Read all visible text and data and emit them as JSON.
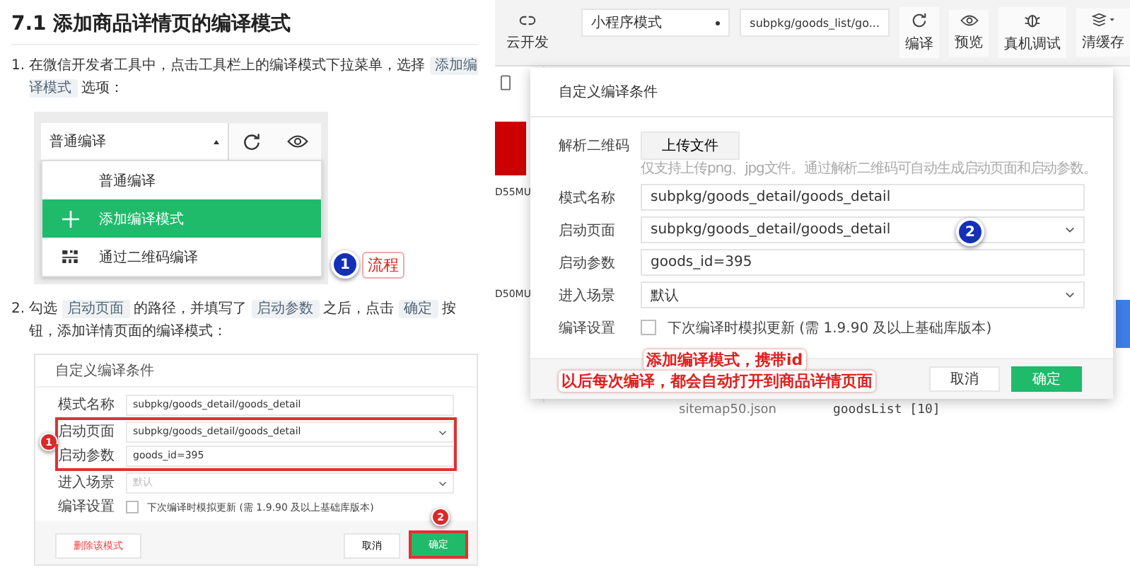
{
  "article": {
    "heading": "7.1 添加商品详情页的编译模式",
    "step_1": {
      "number": "1.",
      "parts": [
        {
          "kind": "text",
          "text": "在微信开发者工具中，点击工具栏上的编译模式下拉菜单，选择"
        },
        {
          "kind": "code",
          "text": "添加编译模式"
        },
        {
          "kind": "text",
          "text": "选项："
        }
      ]
    },
    "figure_1": {
      "mode": "普通编译",
      "menu": [
        {
          "label": "普通编译",
          "selected": false
        },
        {
          "label": "添加编译模式",
          "selected": true
        },
        {
          "label": "通过二维码编译",
          "selected": false
        }
      ],
      "callout": {
        "badge": "1",
        "label": "流程"
      }
    },
    "step_2": {
      "number": "2.",
      "parts": [
        {
          "kind": "text",
          "text": "勾选"
        },
        {
          "kind": "code",
          "text": "启动页面"
        },
        {
          "kind": "text",
          "text": "的路径，并填写了"
        },
        {
          "kind": "code",
          "text": "启动参数"
        },
        {
          "kind": "text",
          "text": "之后，点击"
        },
        {
          "kind": "code",
          "text": "确定"
        },
        {
          "kind": "text",
          "text": "按钮，添加详情页面的编译模式："
        }
      ]
    },
    "figure_2": {
      "title": "自定义编译条件",
      "highlight_badge": "1",
      "fields": [
        {
          "label": "模式名称",
          "kind": "input",
          "value": "subpkg/goods_detail/goods_detail",
          "highlighted": false
        },
        {
          "label": "启动页面",
          "kind": "select",
          "value": "subpkg/goods_detail/goods_detail",
          "highlighted": true
        },
        {
          "label": "启动参数",
          "kind": "input",
          "value": "goods_id=395",
          "highlighted": true
        },
        {
          "label": "进入场景",
          "kind": "select",
          "placeholder": "默认",
          "highlighted": false
        },
        {
          "label": "编译设置",
          "kind": "checkbox",
          "text": "下次编译时模拟更新 (需 1.9.90 及以上基础库版本)",
          "checked": false,
          "highlighted": false
        }
      ],
      "buttons": [
        {
          "label": "删除该模式",
          "kind": "danger",
          "highlighted": false
        },
        {
          "label": "取消",
          "kind": "default",
          "highlighted": false
        },
        {
          "label": "确定",
          "kind": "primary",
          "highlighted": true,
          "badge": "2"
        }
      ]
    }
  },
  "devtools": {
    "toolbar": {
      "cloud_label": "云开发",
      "mode_select": "小程序模式",
      "page_select": "subpkg/goods_list/go...",
      "actions": [
        {
          "label": "编译"
        },
        {
          "label": "预览"
        },
        {
          "label": "真机调试"
        },
        {
          "label": "清缓存"
        }
      ]
    },
    "simulator_texts": [
      "D55MU",
      "D50MU"
    ],
    "files": [
      {
        "name": "sitemap50.json"
      }
    ],
    "console_line": "goodsList [10]",
    "dialog": {
      "title": "自定义编译条件",
      "qr_row": {
        "label": "解析二维码",
        "button": "上传文件",
        "hint": "仅支持上传png、jpg文件。通过解析二维码可自动生成启动页面和启动参数。"
      },
      "fields": [
        {
          "label": "模式名称",
          "kind": "input",
          "value": "subpkg/goods_detail/goods_detail"
        },
        {
          "label": "启动页面",
          "kind": "select",
          "value": "subpkg/goods_detail/goods_detail"
        },
        {
          "label": "启动参数",
          "kind": "input",
          "value": "goods_id=395"
        },
        {
          "label": "进入场景",
          "kind": "select",
          "placeholder": "默认"
        },
        {
          "label": "编译设置",
          "kind": "checkbox",
          "text": "下次编译时模拟更新 (需 1.9.90 及以上基础库版本)",
          "checked": false
        }
      ],
      "buttons": [
        {
          "label": "取消",
          "kind": "default"
        },
        {
          "label": "确定",
          "kind": "primary"
        }
      ],
      "badge": "2",
      "notes": [
        "添加编译模式，携带id",
        "以后每次编译，都会自动打开到商品详情页面"
      ]
    }
  }
}
